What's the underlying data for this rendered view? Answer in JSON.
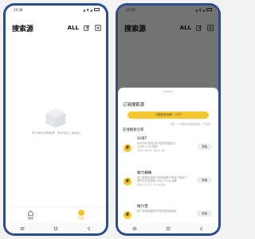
{
  "status_bar": {
    "time": "19:28",
    "icons": "▣ ▣ ◎ ·",
    "network": "▲ ▼ ◢"
  },
  "app": {
    "title": "搜索源",
    "all_label": "ALL"
  },
  "empty_state": {
    "text": "未订阅任何搜索源，请先前往上面添加"
  },
  "bottom_nav": {
    "items": [
      {
        "label": "搜索"
      },
      {
        "label": "订阅"
      }
    ]
  },
  "sheet": {
    "title": "订阅搜索源",
    "subscribe_label": "订阅任务仓库：27个",
    "hint": "只是一个仓库可阅读搜索源，不承诺",
    "section_title": "在线搜索仓库",
    "install_label": "安装",
    "sources": [
      {
        "icon": "#",
        "name": "SOBT",
        "desc": "最好的BT搜索,种子搜索神器站点 sobt01.top 最新",
        "date": "2022-09-12 16:21:00"
      },
      {
        "icon": "#",
        "name": "磁力蜘蛛",
        "desc": "磁力蜘蛛免费磁力链接搜索引擎磁力搜索下载网站资源搜索 infos11.top 最新",
        "date": "2022-01-25 15:40:00"
      },
      {
        "icon": "#",
        "name": "磁力宝",
        "desc": "磁力宝资源搜索引擎资源全面更新"
      }
    ]
  },
  "colors": {
    "frame": "#2b4d8c",
    "accent": "#f5c62e"
  }
}
